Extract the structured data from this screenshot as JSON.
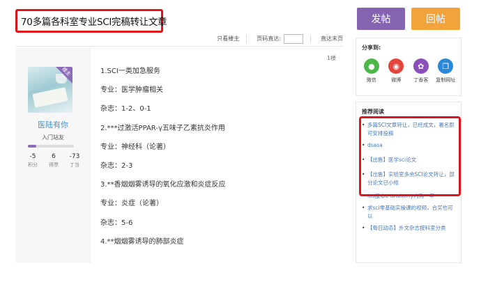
{
  "post_title": "70多篇各科室专业SCI完稿转让文章",
  "toolbar": {
    "only_author": "只看楼主",
    "jump_label": "页码直达:",
    "jump_value": "",
    "last_page": "直达末页"
  },
  "post": {
    "floor": "1楼",
    "author": {
      "name": "医陆有你",
      "badge": "楼主",
      "level": "入门站友",
      "level_progress": 0.18,
      "stats": [
        {
          "value": "-5",
          "label": "积分"
        },
        {
          "value": "6",
          "label": "得票"
        },
        {
          "value": "-73",
          "label": "丁当"
        }
      ]
    },
    "lines": [
      "1.SCI一类加急服务",
      "专业：医学肿瘤相关",
      "杂志：1-2、0-1",
      "2.***过激活PPAR-γ五味子乙素抗炎作用",
      "专业：神经科（论著）",
      "杂志：2-3",
      "3.**香烟烟雾诱导的氧化应激和炎症反应",
      "专业：炎症（论著）",
      "杂志：5-6",
      "4.**烟烟雾诱导的肺部炎症"
    ]
  },
  "actions": {
    "post_button": "发帖",
    "reply_button": "回帖"
  },
  "share": {
    "title": "分享到:",
    "items": [
      {
        "label": "微信",
        "icon": "wechat-icon",
        "color": "#4cb84a"
      },
      {
        "label": "微博",
        "icon": "weibo-icon",
        "color": "#e6453c"
      },
      {
        "label": "丁香客",
        "icon": "dingxiangke-icon",
        "color": "#8a4fb8"
      },
      {
        "label": "复制网址",
        "icon": "copy-icon",
        "color": "#2c88d6"
      }
    ]
  },
  "recommended": {
    "title": "推荐阅读",
    "items": [
      "多篇SCI文章转让，已经成文，署名即可安排投稿",
      "dsasa",
      "【出售】医学sci论文",
      "【出售】实验室多余SCI论文转让，部分论文已小修",
      "ios版本e-anatomy内购一年",
      "求sci零基础实操课的视频，合买也可以",
      "【每日动态】外文杂志按科室分类"
    ]
  }
}
